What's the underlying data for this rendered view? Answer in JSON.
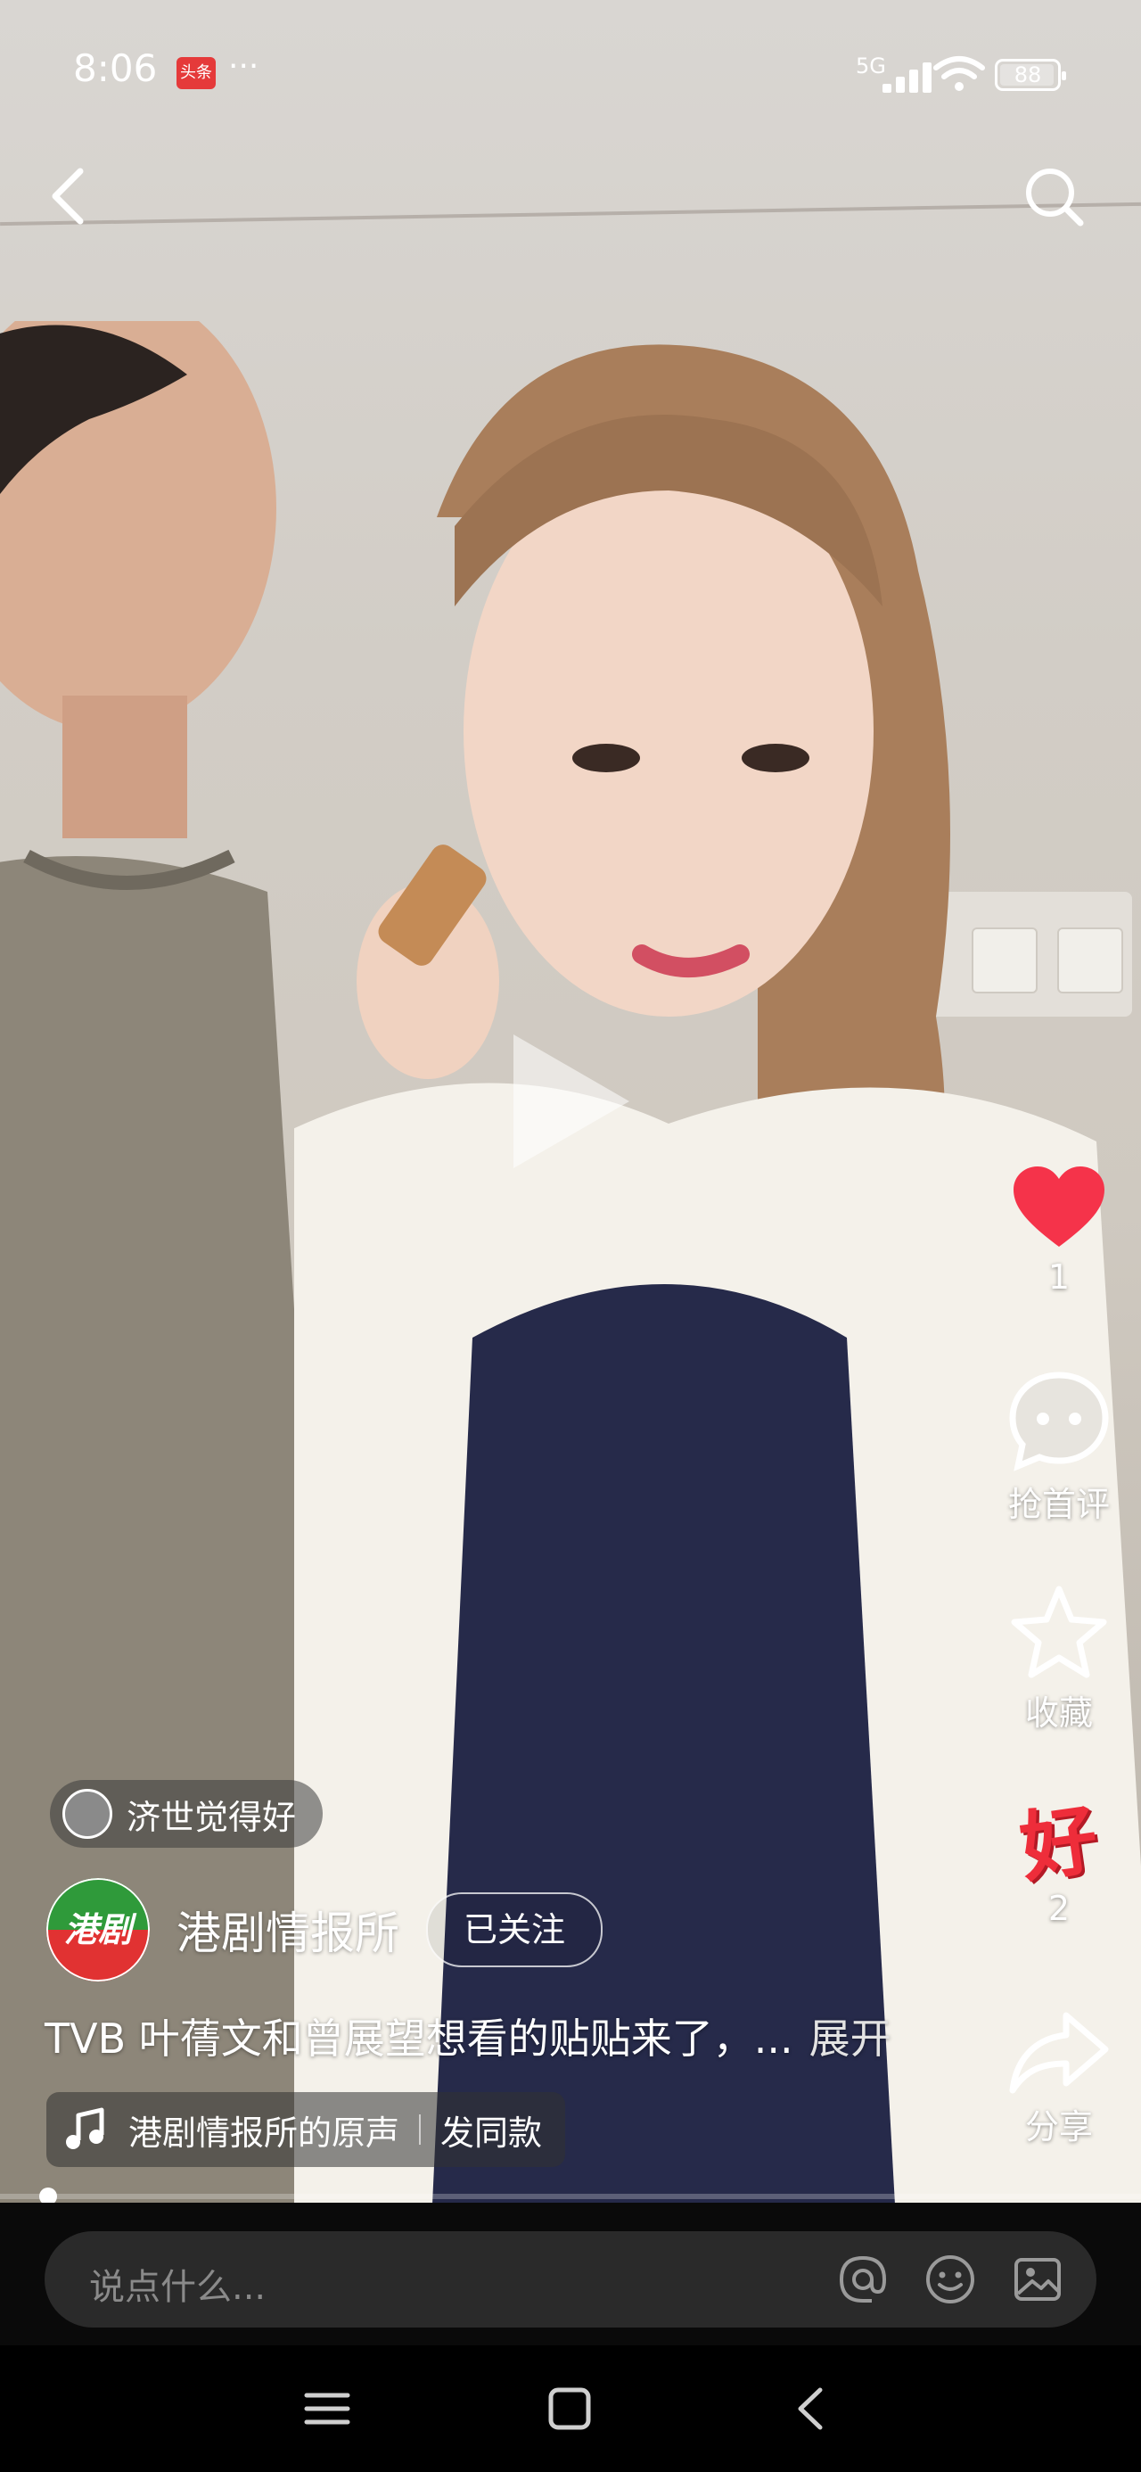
{
  "status_bar": {
    "time": "8:06",
    "app_badge": "头条",
    "more": "···",
    "network": "5G",
    "battery": "88"
  },
  "overlay": {
    "hot_user": "济世觉得好",
    "author_name": "港剧情报所",
    "author_logo_text": "港剧",
    "follow_label": "已关注",
    "caption": "TVB 叶蒨文和曾展望想看的贴贴来了，...",
    "expand_label": "展开",
    "music_title": "港剧情报所的原声",
    "music_action": "发同款"
  },
  "actions": {
    "like_count": "1",
    "comment_label": "抢首评",
    "favorite_label": "收藏",
    "good_glyph": "好",
    "good_count": "2",
    "share_label": "分享"
  },
  "comment_bar": {
    "placeholder": "说点什么..."
  },
  "colors": {
    "like": "#f5334a",
    "good": "#ee2d3a",
    "logo_top": "#2f9a3a",
    "logo_bottom": "#e13232"
  }
}
